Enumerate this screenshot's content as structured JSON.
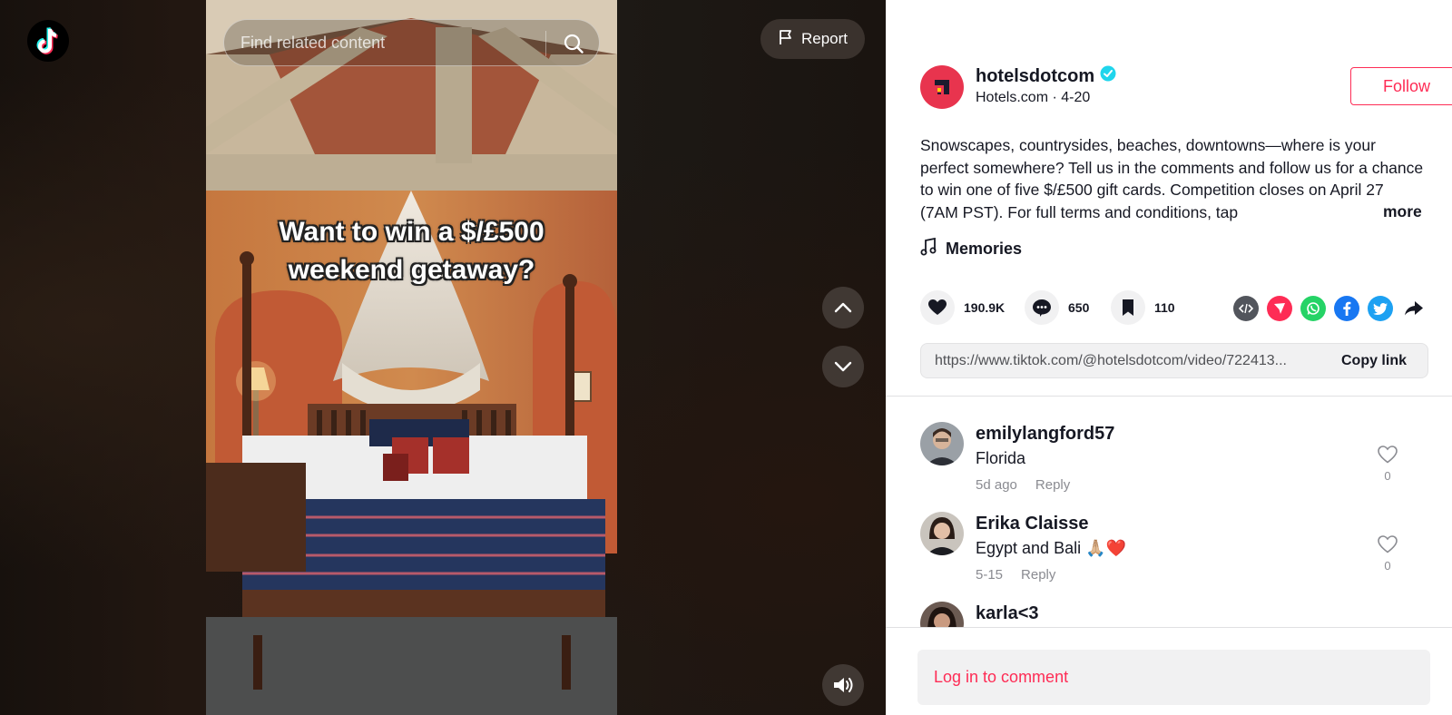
{
  "search": {
    "placeholder": "Find related content"
  },
  "report": {
    "label": "Report"
  },
  "video": {
    "caption_line1": "Want to win a $/£500",
    "caption_line2": "weekend getaway?"
  },
  "author": {
    "username": "hotelsdotcom",
    "verified": true,
    "display_name": "Hotels.com",
    "date": "4-20",
    "brand_color": "#e8344e"
  },
  "follow": {
    "label": "Follow"
  },
  "description": {
    "text": "Snowscapes, countrysides, beaches, downtowns—where is your perfect somewhere? Tell us in the comments and follow us for a chance to win one of five $/£500 gift cards. Competition closes on April 27 (7AM PST). For full terms and conditions, tap",
    "more_label": "more"
  },
  "music": {
    "title": "Memories"
  },
  "stats": {
    "likes": "190.9K",
    "comments": "650",
    "saves": "110"
  },
  "share_icons": [
    "embed-icon",
    "send-to-friends-icon",
    "whatsapp-icon",
    "facebook-icon",
    "twitter-icon",
    "share-arrow-icon"
  ],
  "link": {
    "url": "https://www.tiktok.com/@hotelsdotcom/video/722413...",
    "copy_label": "Copy link"
  },
  "comments": [
    {
      "user": "emilylangford57",
      "text": "Florida",
      "time": "5d ago",
      "reply": "Reply",
      "likes": "0"
    },
    {
      "user": "Erika Claisse",
      "text": "Egypt and Bali 🙏🏼❤️",
      "time": "5-15",
      "reply": "Reply",
      "likes": "0"
    },
    {
      "user": "karla<3",
      "text": "",
      "time": "",
      "reply": "",
      "likes": ""
    }
  ],
  "login": {
    "label": "Log in to comment"
  },
  "colors": {
    "accent": "#fe2c55",
    "verified": "#20d5ec"
  }
}
